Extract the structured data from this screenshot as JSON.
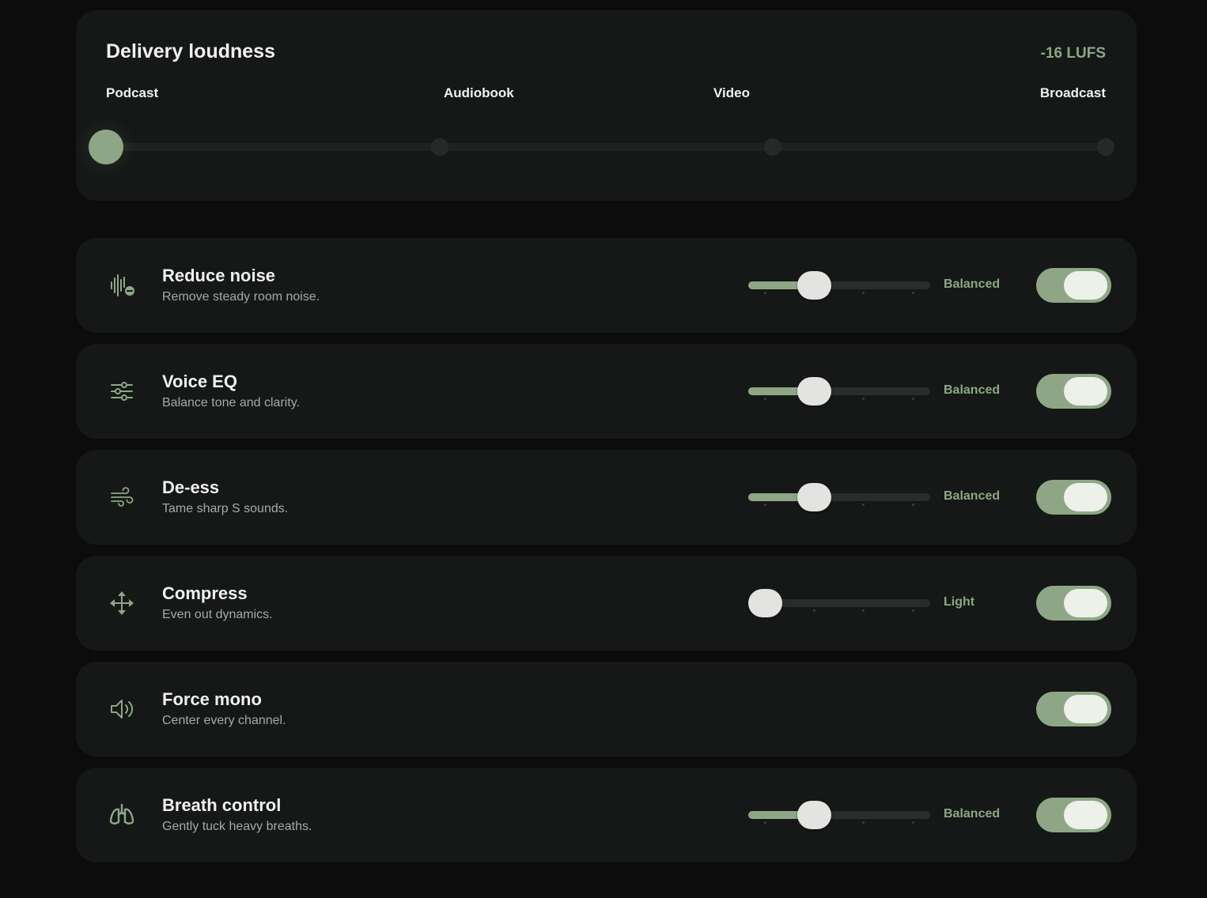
{
  "loudness": {
    "title": "Delivery loudness",
    "value": "-16 LUFS",
    "presets": [
      "Podcast",
      "Audiobook",
      "Video",
      "Broadcast"
    ],
    "selected_index": 0
  },
  "settings": [
    {
      "id": "reduce-noise",
      "icon": "waveform-minus-icon",
      "title": "Reduce noise",
      "description": "Remove steady room noise.",
      "has_slider": true,
      "level_index": 1,
      "level": "Balanced",
      "enabled": true
    },
    {
      "id": "voice-eq",
      "icon": "equalizer-sliders-icon",
      "title": "Voice EQ",
      "description": "Balance tone and clarity.",
      "has_slider": true,
      "level_index": 1,
      "level": "Balanced",
      "enabled": true
    },
    {
      "id": "de-ess",
      "icon": "wind-icon",
      "title": "De-ess",
      "description": "Tame sharp S sounds.",
      "has_slider": true,
      "level_index": 1,
      "level": "Balanced",
      "enabled": true
    },
    {
      "id": "compress",
      "icon": "arrows-move-icon",
      "title": "Compress",
      "description": "Even out dynamics.",
      "has_slider": true,
      "level_index": 0,
      "level": "Light",
      "enabled": true
    },
    {
      "id": "force-mono",
      "icon": "speaker-icon",
      "title": "Force mono",
      "description": "Center every channel.",
      "has_slider": false,
      "enabled": true
    },
    {
      "id": "breath-control",
      "icon": "lungs-icon",
      "title": "Breath control",
      "description": "Gently tuck heavy breaths.",
      "has_slider": true,
      "level_index": 1,
      "level": "Balanced",
      "enabled": true
    }
  ],
  "slider_steps": 4,
  "colors": {
    "accent": "#8ea685",
    "card": "#151816",
    "background": "#0b0c0b",
    "text": "#f1f2ee",
    "muted_text": "#a6aaa4"
  }
}
